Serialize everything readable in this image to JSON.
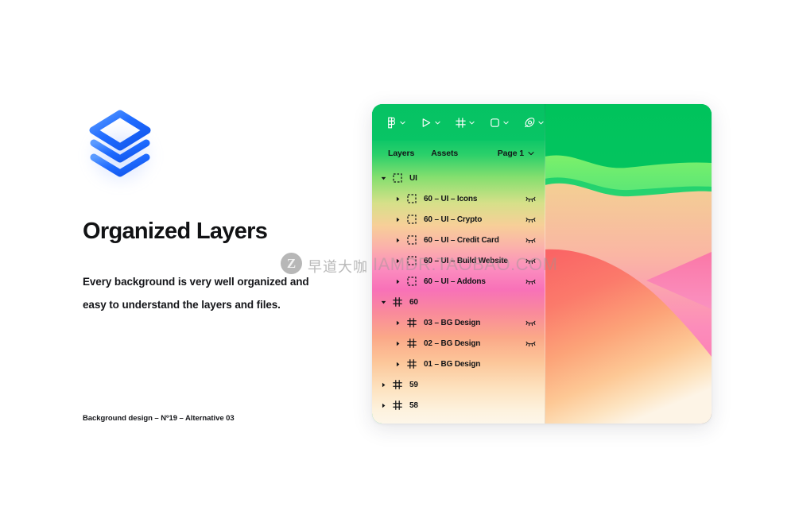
{
  "brand": {
    "logo_icon": "stacked-layers-icon",
    "accent_blue": "#1f6bff"
  },
  "hero": {
    "title": "Organized Layers",
    "body_line1": "Every background  is very well organized and",
    "body_line2": "easy to understand the layers and files.",
    "footnote": "Background design – Nº19 – Alternative 03"
  },
  "watermark": {
    "mark": "Z",
    "cn_text": "早道大咖",
    "url_text": "IAMDR.TAOBAO.COM"
  },
  "figma": {
    "toolbar": [
      {
        "icon": "figma-logo-icon",
        "label": "Figma menu",
        "has_chevron": true
      },
      {
        "icon": "move-tool-icon",
        "label": "Move tool",
        "has_chevron": true
      },
      {
        "icon": "frame-tool-icon",
        "label": "Frame tool",
        "has_chevron": true
      },
      {
        "icon": "shape-tool-icon",
        "label": "Shape tool",
        "has_chevron": true
      },
      {
        "icon": "pen-tool-icon",
        "label": "Pen tool",
        "has_chevron": true
      }
    ],
    "tabs": [
      {
        "label": "Layers",
        "active": true
      },
      {
        "label": "Assets",
        "active": false
      }
    ],
    "page_selector": {
      "label": "Page 1",
      "chevron_icon": "chevron-down-icon"
    },
    "layers": [
      {
        "name": "UI",
        "icon": "group-icon",
        "depth": 0,
        "expanded": true,
        "caret": "down",
        "eye": false
      },
      {
        "name": "60 – UI – Icons",
        "icon": "group-icon",
        "depth": 1,
        "expanded": false,
        "caret": "right",
        "eye": true
      },
      {
        "name": "60 – UI – Crypto",
        "icon": "group-icon",
        "depth": 1,
        "expanded": false,
        "caret": "right",
        "eye": true
      },
      {
        "name": "60 – UI – Credit Card",
        "icon": "group-icon",
        "depth": 1,
        "expanded": false,
        "caret": "right",
        "eye": true
      },
      {
        "name": "60 – UI – Build Website",
        "icon": "group-icon",
        "depth": 1,
        "expanded": false,
        "caret": "right",
        "eye": true
      },
      {
        "name": "60 – UI – Addons",
        "icon": "group-icon",
        "depth": 1,
        "expanded": false,
        "caret": "right",
        "eye": true
      },
      {
        "name": "60",
        "icon": "frame-icon",
        "depth": 0,
        "expanded": true,
        "caret": "down",
        "eye": false
      },
      {
        "name": "03 – BG Design",
        "icon": "frame-icon",
        "depth": 1,
        "expanded": false,
        "caret": "right",
        "eye": true
      },
      {
        "name": "02 – BG Design",
        "icon": "frame-icon",
        "depth": 1,
        "expanded": false,
        "caret": "right",
        "eye": true
      },
      {
        "name": "01 – BG Design",
        "icon": "frame-icon",
        "depth": 1,
        "expanded": false,
        "caret": "right",
        "eye": false
      },
      {
        "name": "59",
        "icon": "frame-icon",
        "depth": 0,
        "expanded": false,
        "caret": "right",
        "eye": false
      },
      {
        "name": "58",
        "icon": "frame-icon",
        "depth": 0,
        "expanded": false,
        "caret": "right",
        "eye": false
      }
    ]
  },
  "artwork": {
    "name": "gradient-wave-background",
    "colors": [
      "#00c75e",
      "#85f06a",
      "#f0d197",
      "#fb8fb0",
      "#fa63a6",
      "#f87a7a",
      "#fcc18c",
      "#fdf5e4"
    ]
  }
}
